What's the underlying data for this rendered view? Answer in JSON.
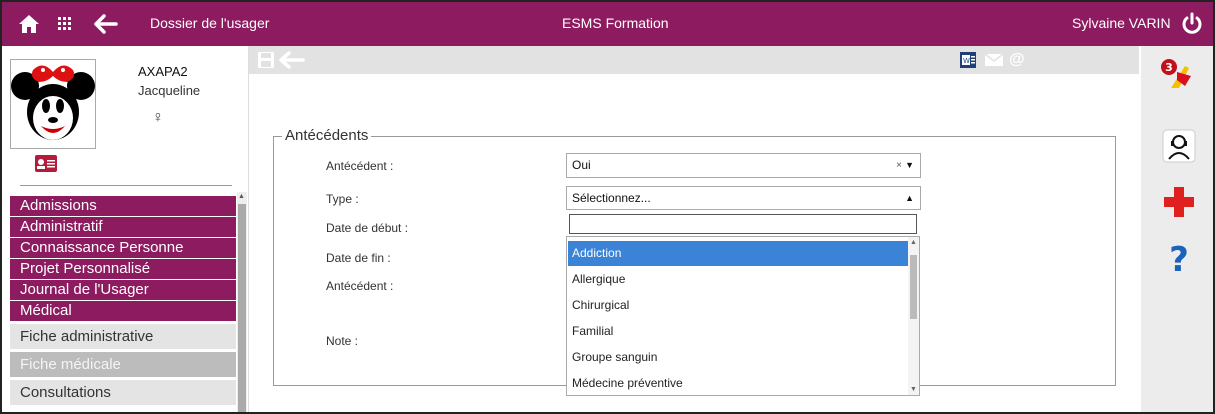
{
  "topbar": {
    "section_title": "Dossier de l'usager",
    "app_title": "ESMS Formation",
    "user_name": "Sylvaine VARIN"
  },
  "patient": {
    "last_name": "AXAPA2",
    "first_name": "Jacqueline",
    "gender_symbol": "♀"
  },
  "menu": {
    "items": [
      {
        "label": "Admissions"
      },
      {
        "label": "Administratif"
      },
      {
        "label": "Connaissance Personne"
      },
      {
        "label": "Projet Personnalisé"
      },
      {
        "label": "Journal de l'Usager"
      },
      {
        "label": "Médical"
      }
    ],
    "sub_items": [
      {
        "label": "Fiche administrative"
      },
      {
        "label": "Fiche médicale"
      },
      {
        "label": "Consultations"
      }
    ]
  },
  "notifications": {
    "count": "3"
  },
  "form": {
    "legend": "Antécédents",
    "labels": {
      "antecedent": "Antécédent :",
      "type": "Type :",
      "date_debut": "Date de début :",
      "date_fin": "Date de fin :",
      "antecedent2": "Antécédent :",
      "note": "Note :"
    },
    "antecedent_value": "Oui",
    "type_placeholder": "Sélectionnez...",
    "search_value": ""
  },
  "dropdown": {
    "options": [
      {
        "label": "Addiction"
      },
      {
        "label": "Allergique"
      },
      {
        "label": "Chirurgical"
      },
      {
        "label": "Familial"
      },
      {
        "label": "Groupe sanguin"
      },
      {
        "label": "Médecine préventive"
      }
    ],
    "selected_index": 0
  },
  "colors": {
    "brand": "#8d1b60",
    "highlight": "#3b83d6",
    "medical_cross": "#e0201e"
  },
  "icons": {
    "home": "home-icon",
    "apps": "apps-grid-icon",
    "back": "arrow-left-icon",
    "power": "power-icon",
    "save": "save-icon",
    "word": "word-export-icon",
    "mail": "mail-icon",
    "at": "at-sign-icon",
    "flag": "notification-flag-icon",
    "support": "support-headset-icon",
    "medical": "medical-cross-icon",
    "help": "help-icon"
  }
}
